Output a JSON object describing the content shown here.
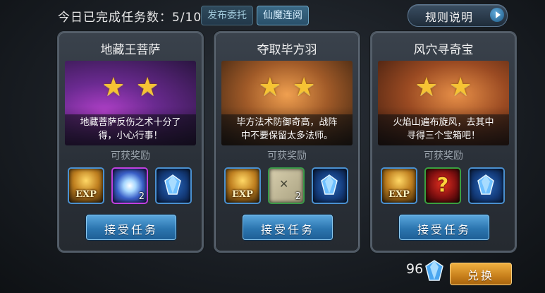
{
  "header": {
    "progress_text": "今日已完成任务数：5/10",
    "tabs": [
      {
        "label": "发布委托",
        "active": false
      },
      {
        "label": "仙魔连阅",
        "active": true
      }
    ],
    "rules_label": "规则说明"
  },
  "cards": [
    {
      "title": "地藏王菩萨",
      "stars": 2,
      "desc_line1": "地藏菩萨反伤之术十分了",
      "desc_line2": "得，小心行事！",
      "reward_title": "可获奖励",
      "rewards": [
        {
          "icon": "exp-icon",
          "text": "EXP"
        },
        {
          "icon": "spirit-orb-icon",
          "count": "2"
        },
        {
          "icon": "blue-gem-icon"
        }
      ],
      "accept_label": "接受任务"
    },
    {
      "title": "夺取毕方羽",
      "stars": 2,
      "desc_line1": "毕方法术防御奇高，战阵",
      "desc_line2": "中不要保留太多法师。",
      "reward_title": "可获奖励",
      "rewards": [
        {
          "icon": "exp-icon",
          "text": "EXP"
        },
        {
          "icon": "map-scroll-icon",
          "count": "2"
        },
        {
          "icon": "blue-gem-icon"
        }
      ],
      "accept_label": "接受任务"
    },
    {
      "title": "风穴寻奇宝",
      "stars": 2,
      "desc_line1": "火焰山遍布旋风，去其中",
      "desc_line2": "寻得三个宝箱吧！",
      "reward_title": "可获奖励",
      "rewards": [
        {
          "icon": "exp-icon",
          "text": "EXP"
        },
        {
          "icon": "mystery-box-icon",
          "text": "?"
        },
        {
          "icon": "blue-gem-icon"
        }
      ],
      "accept_label": "接受任务"
    }
  ],
  "footer": {
    "currency_amount": "96",
    "currency_icon": "blue-gem-icon",
    "exchange_label": "兑换"
  },
  "colors": {
    "accent_blue": "#2c76b0",
    "star_gold": "#f6c334",
    "exchange_orange": "#c8801c"
  }
}
